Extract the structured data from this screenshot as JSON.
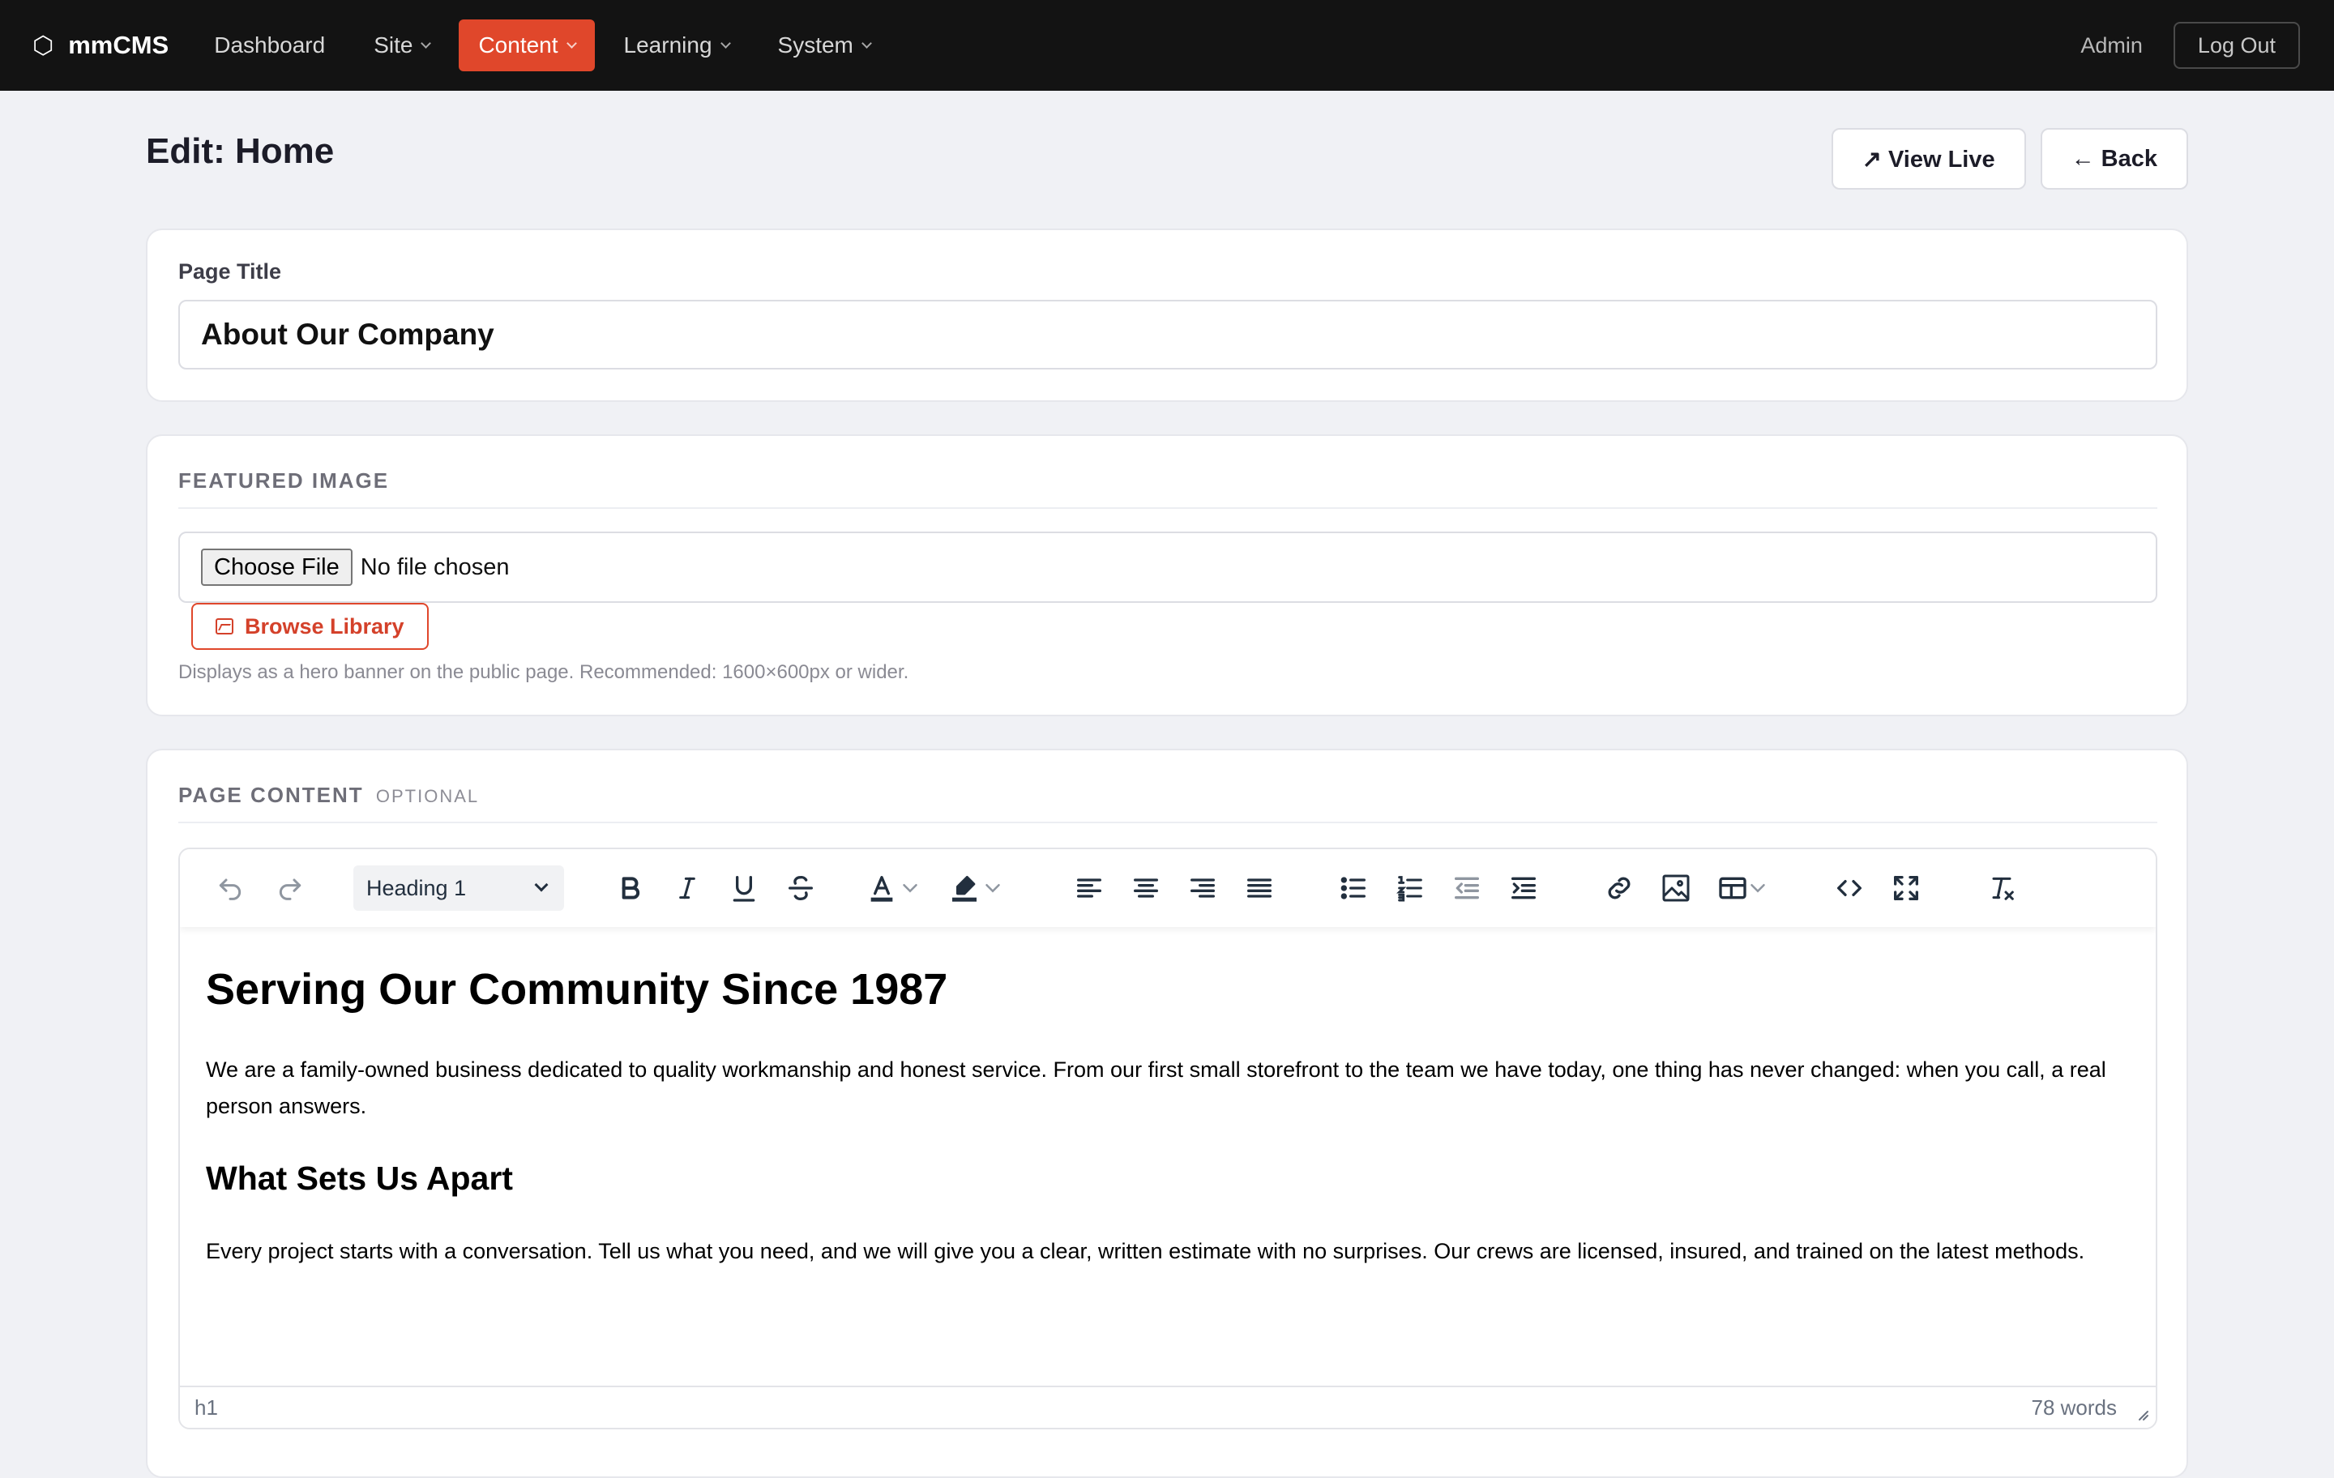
{
  "app": {
    "brand_icon": "⬡",
    "brand_name": "mmCMS",
    "accent": "#e0472b"
  },
  "nav": {
    "items": [
      {
        "label": "Dashboard",
        "dropdown": false,
        "active": false
      },
      {
        "label": "Site",
        "dropdown": true,
        "active": false
      },
      {
        "label": "Content",
        "dropdown": true,
        "active": true
      },
      {
        "label": "Learning",
        "dropdown": true,
        "active": false
      },
      {
        "label": "System",
        "dropdown": true,
        "active": false
      }
    ],
    "user": "Admin",
    "logout": "Log Out"
  },
  "header": {
    "title": "Edit: Home",
    "view_live": "↗ View Live",
    "back": "← Back"
  },
  "page_title_field": {
    "label": "Page Title",
    "value": "About Our Company"
  },
  "featured_image": {
    "section_label": "FEATURED IMAGE",
    "choose_file": "Choose File",
    "file_status": "No file chosen",
    "browse": "Browse Library",
    "hint": "Displays as a hero banner on the public page. Recommended: 1600×600px or wider."
  },
  "page_content": {
    "section_label": "PAGE CONTENT",
    "optional": "OPTIONAL",
    "toolbar": {
      "format": "Heading 1",
      "icons": [
        "undo-icon",
        "redo-icon",
        "bold-icon",
        "italic-icon",
        "underline-icon",
        "strikethrough-icon",
        "text-color-icon",
        "highlight-icon",
        "align-left-icon",
        "align-center-icon",
        "align-right-icon",
        "align-justify-icon",
        "bullet-list-icon",
        "numbered-list-icon",
        "outdent-icon",
        "indent-icon",
        "link-icon",
        "image-icon",
        "table-icon",
        "code-icon",
        "fullscreen-icon",
        "clear-formatting-icon"
      ]
    },
    "body": {
      "h1": "Serving Our Community Since 1987",
      "p1": "We are a family-owned business dedicated to quality workmanship and honest service. From our first small storefront to the team we have today, one thing has never changed: when you call, a real person answers.",
      "h2": "What Sets Us Apart",
      "p2": "Every project starts with a conversation. Tell us what you need, and we will give you a clear, written estimate with no surprises. Our crews are licensed, insured, and trained on the latest methods."
    },
    "status": {
      "path": "h1",
      "words": "78 words"
    }
  }
}
